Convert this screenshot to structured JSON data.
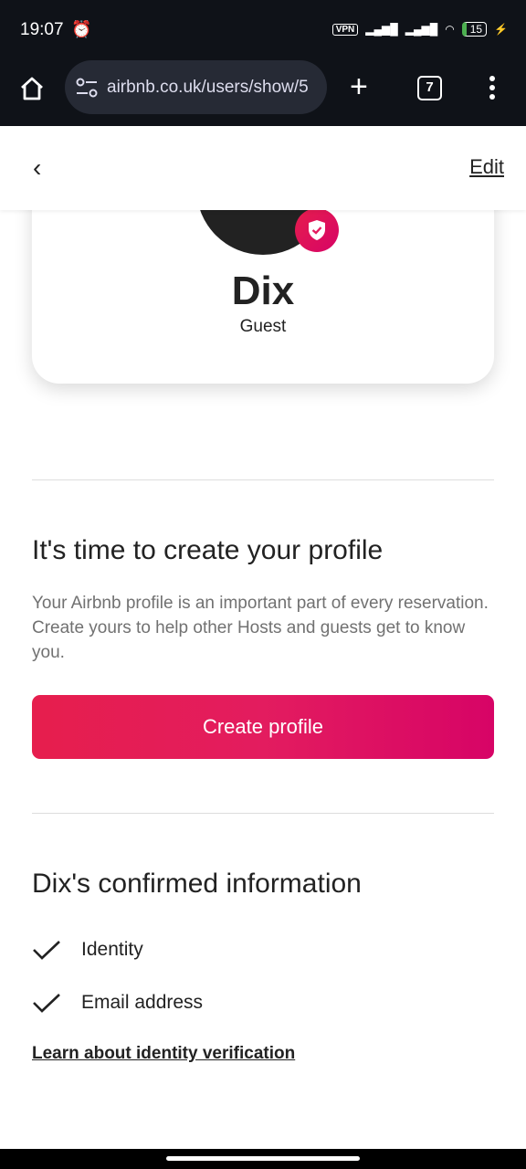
{
  "status_bar": {
    "time": "19:07",
    "vpn": "VPN",
    "battery": "15",
    "icons": [
      "alarm-icon",
      "notification-icon",
      "signal-icon",
      "signal-icon",
      "wifi-icon",
      "battery-icon",
      "charging-icon"
    ]
  },
  "browser": {
    "url": "airbnb.co.uk/users/show/5",
    "tab_count": "7"
  },
  "header": {
    "edit_label": "Edit"
  },
  "profile": {
    "name": "Dix",
    "role": "Guest"
  },
  "create_section": {
    "title": "It's time to create your profile",
    "description": "Your Airbnb profile is an important part of every reservation. Create yours to help other Hosts and guests get to know you.",
    "button_label": "Create profile"
  },
  "confirmed": {
    "title": "Dix's confirmed information",
    "items": [
      "Identity",
      "Email address"
    ],
    "link": "Learn about identity verification"
  },
  "colors": {
    "accent": "#e31c5f",
    "text": "#222222",
    "muted": "#717171"
  }
}
